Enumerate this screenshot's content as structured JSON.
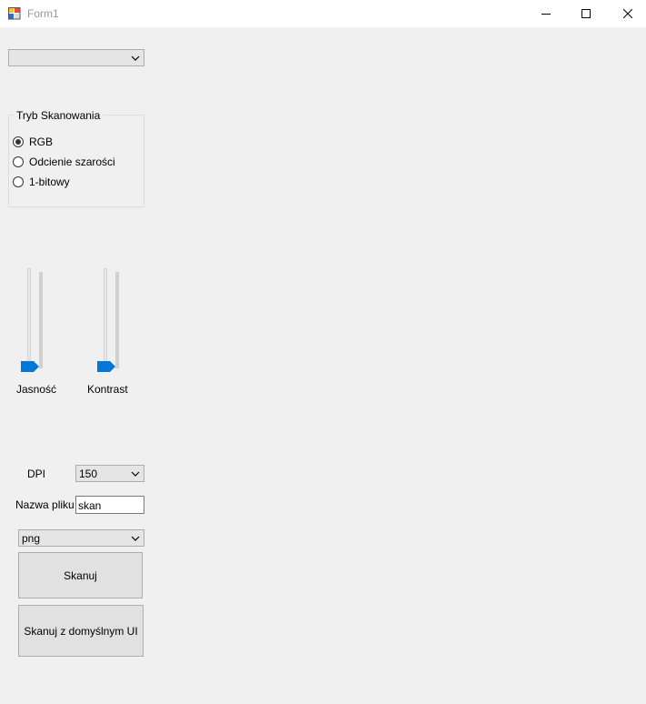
{
  "window": {
    "title": "Form1",
    "icon": "winforms-app-icon",
    "controls": {
      "minimize_icon": "minimize-icon",
      "maximize_icon": "maximize-icon",
      "close_icon": "close-icon"
    }
  },
  "device_combo": {
    "value": ""
  },
  "scan_mode": {
    "title": "Tryb Skanowania",
    "options": [
      {
        "label": "RGB",
        "checked": true
      },
      {
        "label": "Odcienie szarości",
        "checked": false
      },
      {
        "label": "1-bitowy",
        "checked": false
      }
    ]
  },
  "sliders": {
    "brightness": {
      "label": "Jasność",
      "level": 0
    },
    "contrast": {
      "label": "Kontrast",
      "level": 0
    }
  },
  "dpi": {
    "label": "DPI",
    "value": "150"
  },
  "filename": {
    "label": "Nazwa pliku",
    "value": "skan"
  },
  "format_combo": {
    "value": "png"
  },
  "buttons": {
    "scan": "Skanuj",
    "scan_default_ui": "Skanuj z domyślnym UI"
  },
  "colors": {
    "accent": "#0078d7",
    "window_background": "#f0f0f0"
  }
}
